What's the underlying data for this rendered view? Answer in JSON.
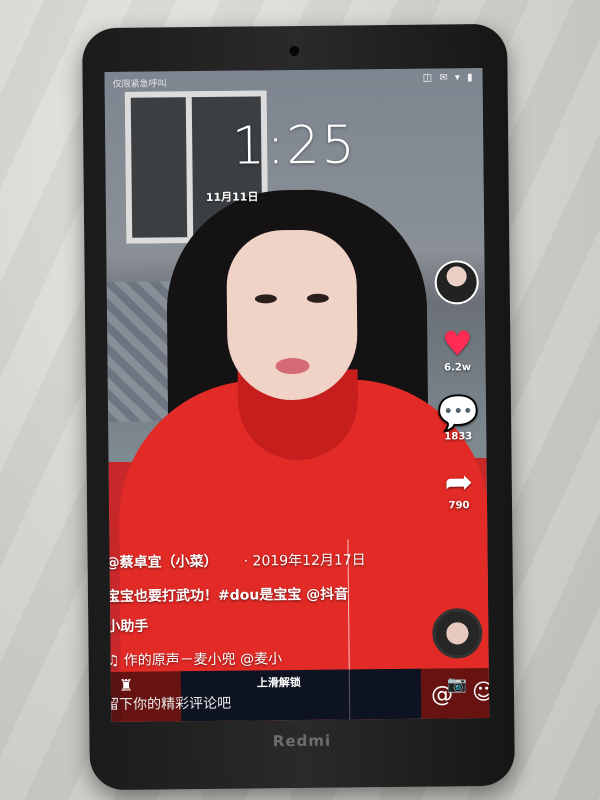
{
  "device": {
    "brand": "Redmi"
  },
  "status_bar": {
    "carrier": "仅限紧急呼叫",
    "icons": "◫ ✉ ▾ ▮"
  },
  "lock_screen": {
    "time": "1:25",
    "date": "11月11日",
    "unlock_hint": "上滑解锁"
  },
  "video": {
    "author": "@蔡卓宜（小菜）",
    "post_date": "· 2019年12月17日",
    "caption_line1": "宝宝也要打武功！#dou是宝宝 @抖音",
    "caption_line2": "小助手",
    "music": "♫ 作的原声－麦小兜  @麦小",
    "stats": {
      "likes": "6.2w",
      "comments": "1833",
      "shares": "790"
    },
    "comment_placeholder": "留下你的精彩评论吧"
  },
  "icons": {
    "like": "heart-icon",
    "comment": "comment-icon",
    "share": "share-icon",
    "at": "at-icon",
    "camera": "camera-icon",
    "music": "music-disc-icon"
  },
  "colors": {
    "like": "#fe2c55",
    "hoodie": "#e22a26",
    "phone_body": "#1b1b1b"
  }
}
